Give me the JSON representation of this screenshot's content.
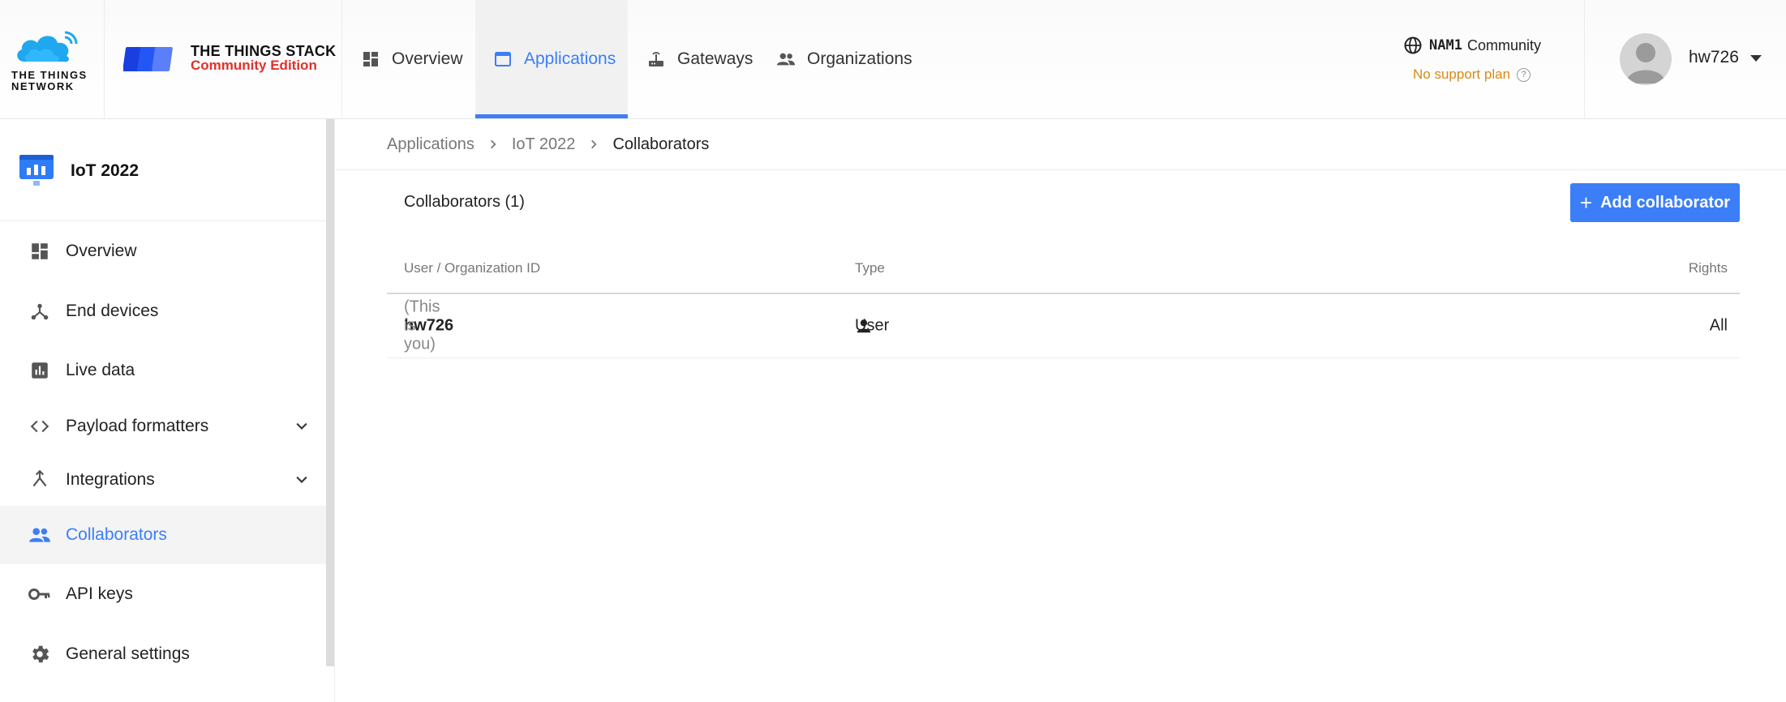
{
  "header": {
    "ttn_logo_text": "THE THINGS NETWORK",
    "tts_title": "THE THINGS STACK",
    "tts_subtitle": "Community Edition",
    "nav": [
      {
        "label": "Overview",
        "icon": "dashboard-icon"
      },
      {
        "label": "Applications",
        "icon": "window-icon",
        "active": true
      },
      {
        "label": "Gateways",
        "icon": "router-icon"
      },
      {
        "label": "Organizations",
        "icon": "people-icon"
      }
    ],
    "cluster": {
      "code": "NAM1",
      "label": "Community",
      "plan": "No support plan"
    },
    "user": {
      "name": "hw726"
    }
  },
  "sidebar": {
    "app_name": "IoT 2022",
    "items": [
      {
        "label": "Overview",
        "icon": "dashboard-icon"
      },
      {
        "label": "End devices",
        "icon": "device-hub-icon"
      },
      {
        "label": "Live data",
        "icon": "bar-chart-icon"
      },
      {
        "label": "Payload formatters",
        "icon": "code-icon",
        "expandable": true
      },
      {
        "label": "Integrations",
        "icon": "merge-icon",
        "expandable": true
      },
      {
        "label": "Collaborators",
        "icon": "people-icon",
        "active": true
      },
      {
        "label": "API keys",
        "icon": "key-icon"
      },
      {
        "label": "General settings",
        "icon": "gear-icon"
      }
    ]
  },
  "breadcrumb": [
    "Applications",
    "IoT 2022",
    "Collaborators"
  ],
  "main": {
    "title": "Collaborators (1)",
    "add_button": "Add collaborator",
    "columns": [
      "User / Organization ID",
      "Type",
      "Rights"
    ],
    "rows": [
      {
        "id": "hw726",
        "note": "(This is you)",
        "type": "User",
        "rights": "All"
      }
    ]
  },
  "colors": {
    "accent": "#3b7ef8",
    "warning": "#d88a13",
    "brand_red": "#e0312b"
  }
}
